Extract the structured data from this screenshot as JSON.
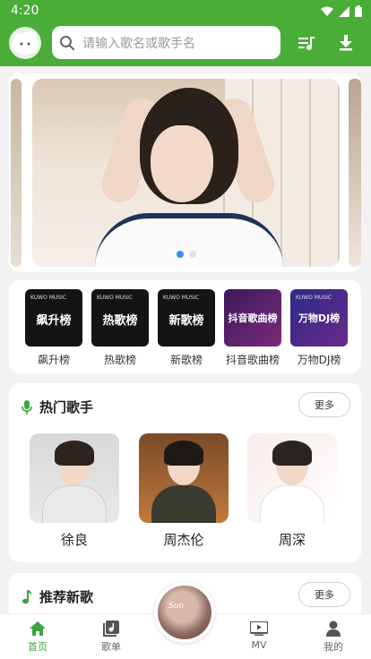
{
  "status": {
    "time": "4:20"
  },
  "search": {
    "placeholder": "请输入歌名或歌手名"
  },
  "banner": {
    "page_index": 1,
    "page_count": 2
  },
  "rankings": [
    {
      "label": "飙升榜",
      "cover_text": "飙升榜",
      "brand": "KUWO MUSIC",
      "bg": "#141414"
    },
    {
      "label": "热歌榜",
      "cover_text": "热歌榜",
      "brand": "KUWO MUSIC",
      "bg": "#141414"
    },
    {
      "label": "新歌榜",
      "cover_text": "新歌榜",
      "brand": "KUWO MUSIC",
      "bg": "#141414"
    },
    {
      "label": "抖音歌曲榜",
      "cover_text": "抖音歌曲榜",
      "brand": "",
      "bg": "#5b1f6b"
    },
    {
      "label": "万物DJ榜",
      "cover_text": "万物DJ榜",
      "brand": "KUWO MUSIC",
      "bg": "#3a2a7a"
    }
  ],
  "hot_singers": {
    "title": "热门歌手",
    "more": "更多",
    "singers": [
      {
        "name": "徐良"
      },
      {
        "name": "周杰伦"
      },
      {
        "name": "周深"
      }
    ]
  },
  "new_songs": {
    "title": "推荐新歌",
    "more": "更多"
  },
  "player": {
    "disc_text": "Sun"
  },
  "nav": [
    {
      "label": "首页",
      "icon": "home-icon",
      "active": true
    },
    {
      "label": "歌单",
      "icon": "playlist-icon",
      "active": false
    },
    {
      "label": "MV",
      "icon": "mv-icon",
      "active": false
    },
    {
      "label": "我的",
      "icon": "profile-icon",
      "active": false
    }
  ],
  "colors": {
    "brand_green": "#4aad38",
    "nav_active": "#3aa540",
    "dot_active": "#3b8df0"
  }
}
